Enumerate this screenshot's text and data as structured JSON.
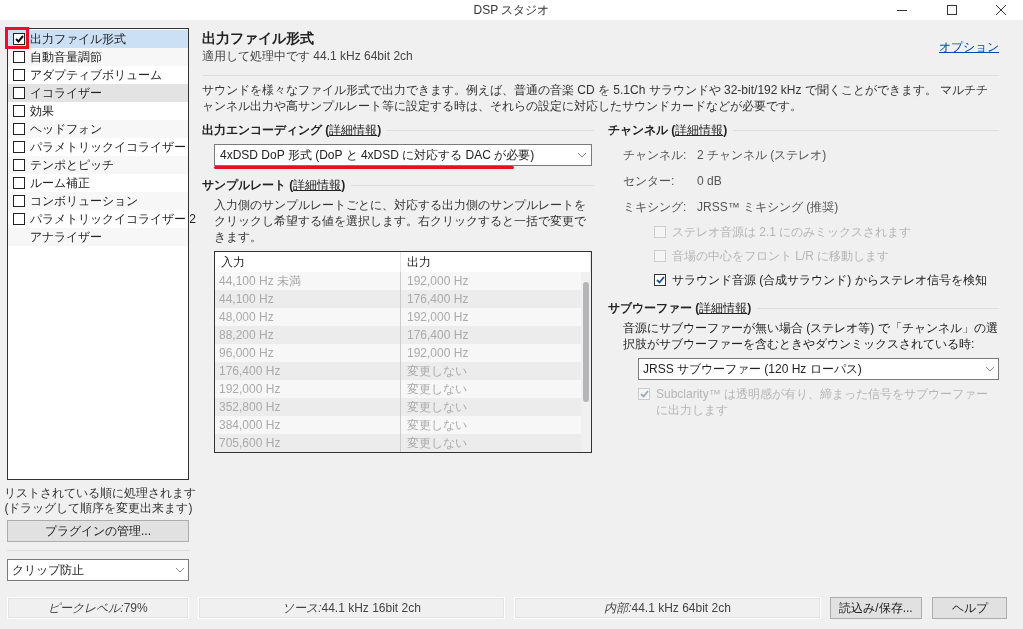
{
  "window": {
    "title": "DSP スタジオ"
  },
  "sidebar": {
    "items": [
      {
        "label": "出力ファイル形式",
        "kind": "checkbox",
        "checked": true,
        "selected": true,
        "hovered": false
      },
      {
        "label": "自動音量調節",
        "kind": "checkbox",
        "checked": false,
        "selected": false,
        "hovered": false
      },
      {
        "label": "アダプティブボリューム",
        "kind": "checkbox",
        "checked": false,
        "selected": false,
        "hovered": false
      },
      {
        "label": "イコライザー",
        "kind": "checkbox",
        "checked": false,
        "selected": false,
        "hovered": true
      },
      {
        "label": "効果",
        "kind": "checkbox",
        "checked": false,
        "selected": false,
        "hovered": false
      },
      {
        "label": "ヘッドフォン",
        "kind": "checkbox",
        "checked": false,
        "selected": false,
        "hovered": false
      },
      {
        "label": "パラメトリックイコライザー",
        "kind": "checkbox",
        "checked": false,
        "selected": false,
        "hovered": false
      },
      {
        "label": "テンポとピッチ",
        "kind": "checkbox",
        "checked": false,
        "selected": false,
        "hovered": false
      },
      {
        "label": "ルーム補正",
        "kind": "checkbox",
        "checked": false,
        "selected": false,
        "hovered": false
      },
      {
        "label": "コンボリューション",
        "kind": "checkbox",
        "checked": false,
        "selected": false,
        "hovered": false
      },
      {
        "label": "パラメトリックイコライザー 2",
        "kind": "checkbox",
        "checked": false,
        "selected": false,
        "hovered": false
      },
      {
        "label": "アナライザー",
        "kind": "plain",
        "selected": false,
        "hovered": false
      }
    ],
    "note": [
      "リストされている順に処理されます",
      "(ドラッグして順序を変更出来ます)"
    ],
    "manage_button": "プラグインの管理...",
    "clip_dropdown": "クリップ防止"
  },
  "main": {
    "title": "出力ファイル形式",
    "subtitle": "適用して処理中です 44.1 kHz 64bit 2ch",
    "options_link": "オプション",
    "description": [
      "サウンドを様々なファイル形式で出力できます。例えば、普通の音楽 CD を 5.1Ch サラウンドや 32-bit/192 kHz で聞くことができます。 マルチチャンネル出力や高",
      "サンプルレート等に設定する時は、それらの設定に対応したサウンドカードなどが必要です。"
    ],
    "encoding": {
      "heading": "出力エンコーディング (",
      "link": "詳細情報",
      "heading_end": ")",
      "value": "4xDSD DoP 形式 (DoP と 4xDSD に対応する DAC が必要)"
    },
    "sample_rate": {
      "heading": "サンプルレート (",
      "link": "詳細情報",
      "heading_end": ")",
      "description": [
        "入力側のサンプルレートごとに、対応する出力側のサンプルレートをクリックし希望",
        "する値を選択します。右クリックすると一括で変更できます。"
      ],
      "columns": [
        "入力",
        "出力"
      ],
      "rows": [
        {
          "input": "44,100 Hz 未満",
          "output": "192,000 Hz"
        },
        {
          "input": "44,100 Hz",
          "output": "176,400 Hz"
        },
        {
          "input": "48,000 Hz",
          "output": "192,000 Hz"
        },
        {
          "input": "88,200 Hz",
          "output": "176,400 Hz"
        },
        {
          "input": "96,000 Hz",
          "output": "192,000 Hz"
        },
        {
          "input": "176,400 Hz",
          "output": "変更しない"
        },
        {
          "input": "192,000 Hz",
          "output": "変更しない"
        },
        {
          "input": "352,800 Hz",
          "output": "変更しない"
        },
        {
          "input": "384,000 Hz",
          "output": "変更しない"
        },
        {
          "input": "705,600 Hz",
          "output": "変更しない"
        }
      ]
    },
    "channel": {
      "heading": "チャンネル (",
      "link": "詳細情報",
      "heading_end": ")",
      "fields": [
        {
          "label": "チャンネル:",
          "value": "2 チャンネル (ステレオ)"
        },
        {
          "label": "センター:",
          "value": "0 dB"
        },
        {
          "label": "ミキシング:",
          "value": "JRSS™ ミキシング (推奨)"
        }
      ],
      "checks": [
        {
          "label": "ステレオ音源は 2.1 にのみミックスされます",
          "checked": false,
          "disabled": true
        },
        {
          "label": "音場の中心をフロント L/R に移動します",
          "checked": false,
          "disabled": true
        },
        {
          "label": "サラウンド音源 (合成サラウンド) からステレオ信号を検知",
          "checked": true,
          "disabled": false
        }
      ]
    },
    "subwoofer": {
      "heading": "サブウーファー (",
      "link": "詳細情報",
      "heading_end": ")",
      "description": [
        "音源にサブウーファーが無い場合 (ステレオ等) で「チャンネル」の選択肢",
        "がサブウーファーを含むときやダウンミックスされている時:"
      ],
      "value": "JRSS サブウーファー (120 Hz ローパス)",
      "check": {
        "label": "Subclarity™ は透明感が有り、締まった信号をサブウーファーに出力します",
        "checked": true,
        "disabled": true
      }
    }
  },
  "status_bar": [
    {
      "label": "ピークレベル:",
      "value": "79%"
    },
    {
      "label": "ソース:",
      "value": "44.1 kHz 16bit 2ch"
    },
    {
      "label": "内部:",
      "value": "44.1 kHz 64bit 2ch"
    }
  ],
  "buttons": [
    "読込み/保存...",
    "ヘルプ"
  ],
  "highlight_box": {
    "color": "#e81123"
  },
  "highlight_underline": {
    "color": "#e81123"
  }
}
